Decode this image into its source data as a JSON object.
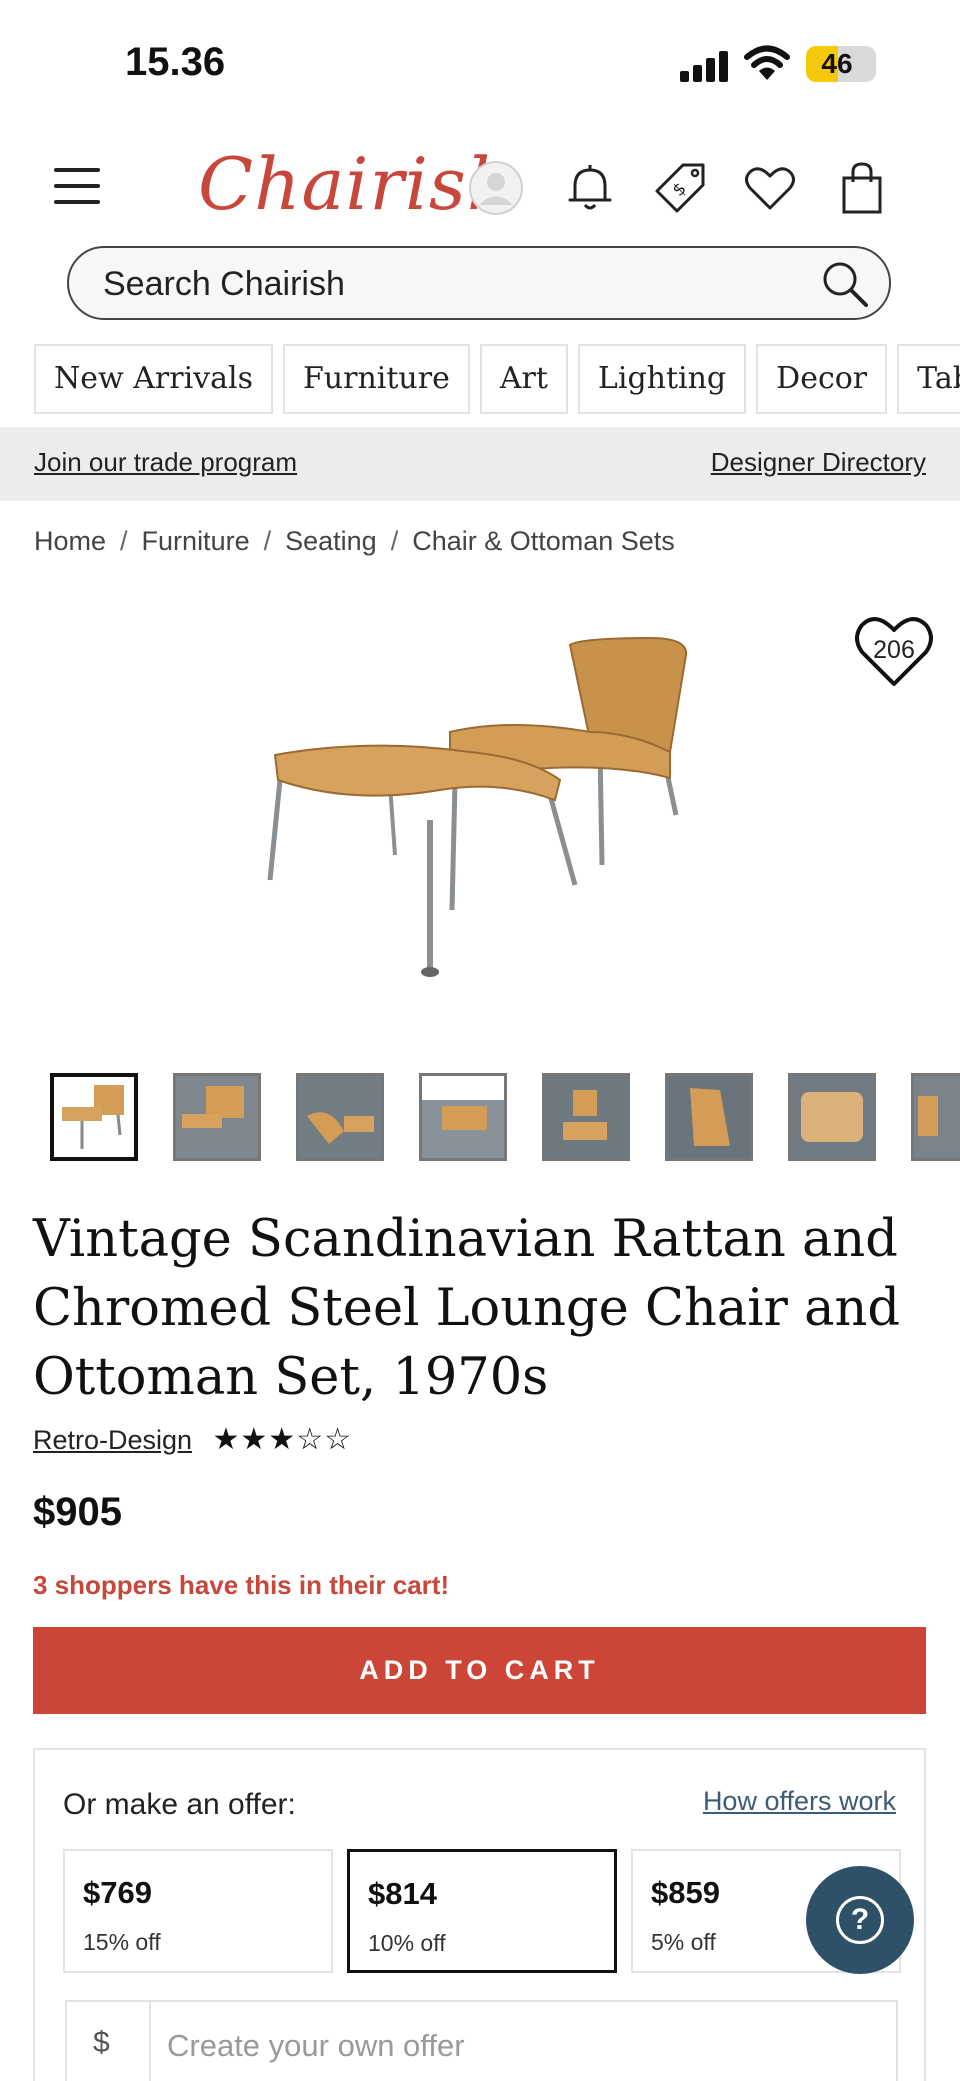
{
  "status_bar": {
    "time": "15.36",
    "battery": "46",
    "battery_level": 0.46
  },
  "header": {
    "logo": "Chairish",
    "icons": [
      "account-icon",
      "bell-icon",
      "price-tag-icon",
      "heart-icon",
      "shopping-bag-icon"
    ]
  },
  "search": {
    "placeholder": "Search Chairish"
  },
  "categories": [
    "New Arrivals",
    "Furniture",
    "Art",
    "Lighting",
    "Decor",
    "Table"
  ],
  "trade_bar": {
    "trade_link": "Join our trade program",
    "directory_link": "Designer Directory"
  },
  "breadcrumb": [
    "Home",
    "Furniture",
    "Seating",
    "Chair & Ottoman Sets"
  ],
  "breadcrumb_separator": "/",
  "favorite": {
    "count": "206"
  },
  "thumbnails": {
    "count": 8,
    "selected_index": 0
  },
  "product": {
    "title": "Vintage Scandinavian Rattan and Chromed Steel Lounge Chair and Ottoman Set, 1970s",
    "seller": "Retro-Design",
    "rating": "★★★☆☆",
    "rating_value": 3,
    "rating_max": 5,
    "price": "$905",
    "urgency": "3 shoppers have this in their cart!",
    "add_to_cart": "ADD TO CART"
  },
  "offer": {
    "label": "Or make an offer:",
    "how_link": "How offers work",
    "options": [
      {
        "price": "$769",
        "off": "15% off"
      },
      {
        "price": "$814",
        "off": "10% off"
      },
      {
        "price": "$859",
        "off": "5% off"
      }
    ],
    "selected_index": 1,
    "currency": "$",
    "custom_placeholder": "Create your own offer"
  },
  "help": {
    "symbol": "?"
  },
  "colors": {
    "brand_red": "#c7483b",
    "button_red": "#cd4536",
    "link_blue": "#3d5a78",
    "fab_blue": "#2f5168"
  }
}
